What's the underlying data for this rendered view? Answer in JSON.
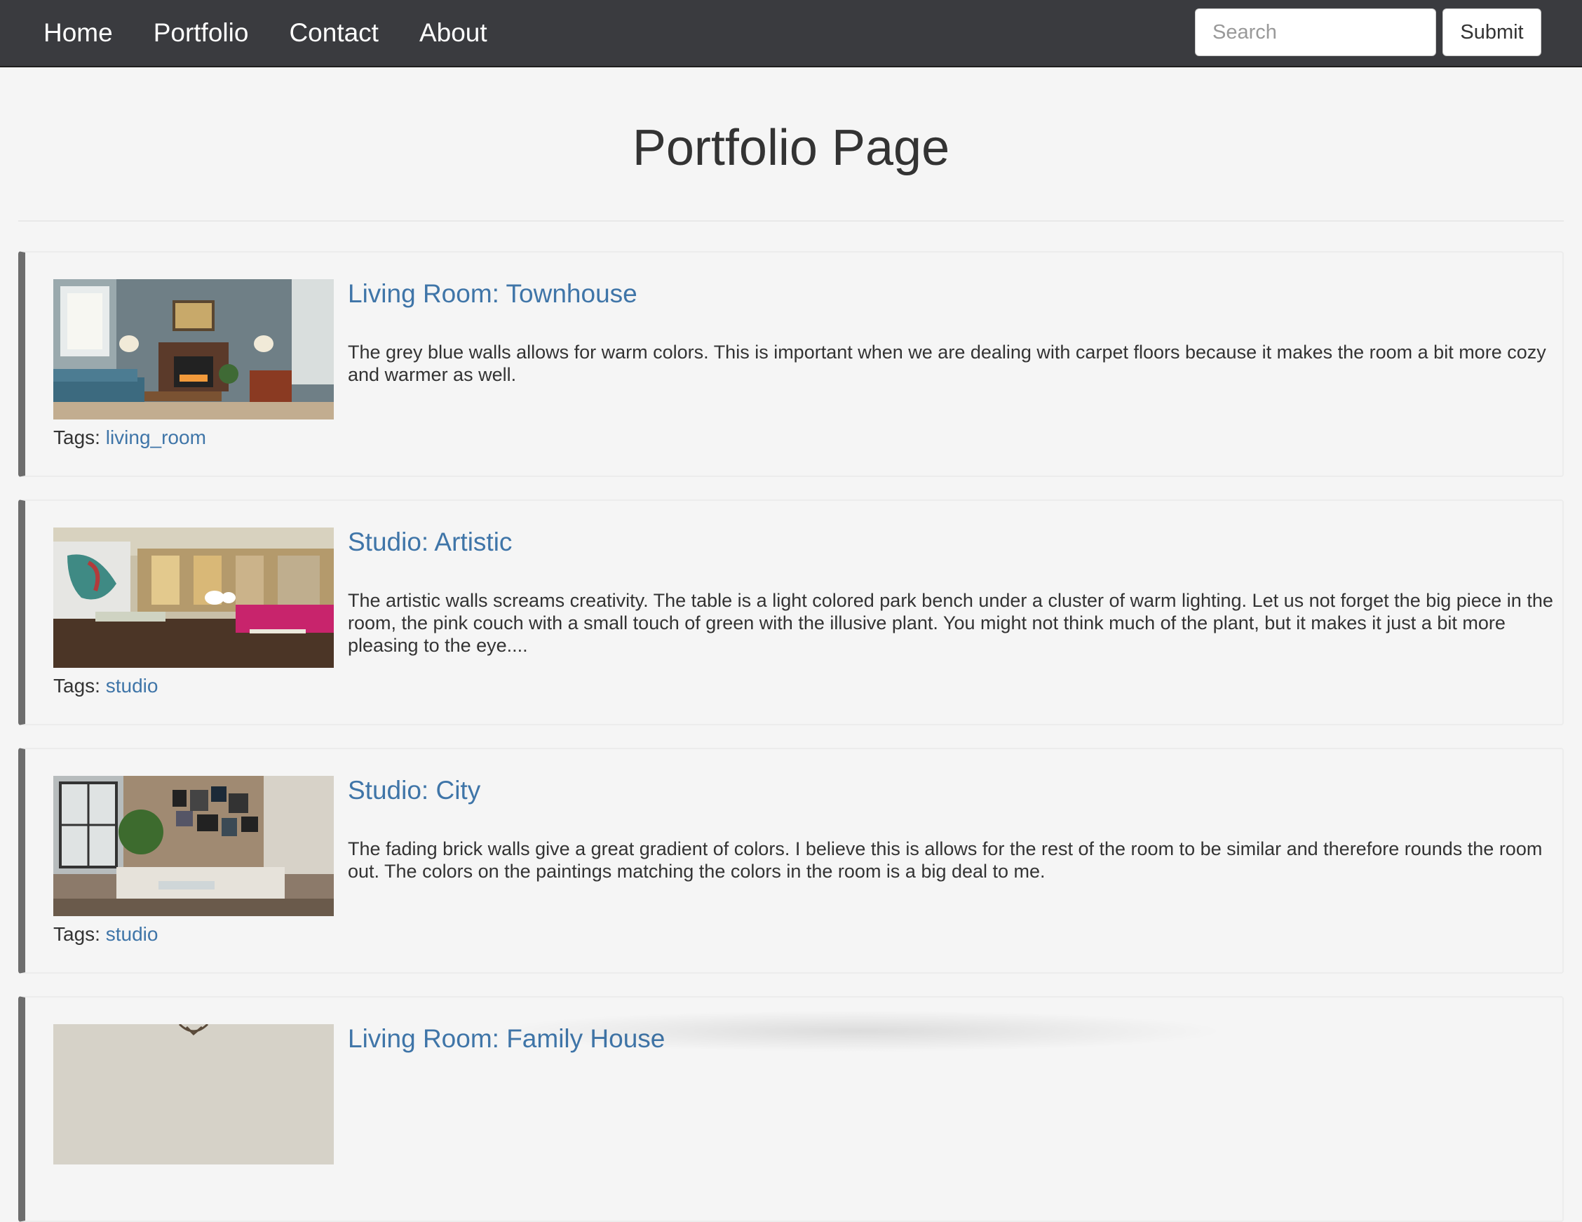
{
  "nav": {
    "links": [
      "Home",
      "Portfolio",
      "Contact",
      "About"
    ],
    "search_placeholder": "Search",
    "submit_label": "Submit"
  },
  "page": {
    "title": "Portfolio Page"
  },
  "tags_label": "Tags:",
  "cards": [
    {
      "title": "Living Room: Townhouse",
      "description": "The grey blue walls allows for warm colors. This is important when we are dealing with carpet floors because it makes the room a bit more cozy and warmer as well.",
      "tag": "living_room"
    },
    {
      "title": "Studio: Artistic",
      "description": "The artistic walls screams creativity. The table is a light colored park bench under a cluster of warm lighting. Let us not forget the big piece in the room, the pink couch with a small touch of green with the illusive plant. You might not think much of the plant, but it makes it just a bit more pleasing to the eye....",
      "tag": "studio"
    },
    {
      "title": "Studio: City",
      "description": "The fading brick walls give a great gradient of colors. I believe this is allows for the rest of the room to be similar and therefore rounds the room out. The colors on the paintings matching the colors in the room is a big deal to me.",
      "tag": "studio"
    },
    {
      "title": "Living Room: Family House",
      "description": "",
      "tag": ""
    }
  ],
  "colors": {
    "navbar_bg": "#3a3b3f",
    "link_blue": "#3f75a8",
    "card_accent": "#6d6d6d"
  }
}
